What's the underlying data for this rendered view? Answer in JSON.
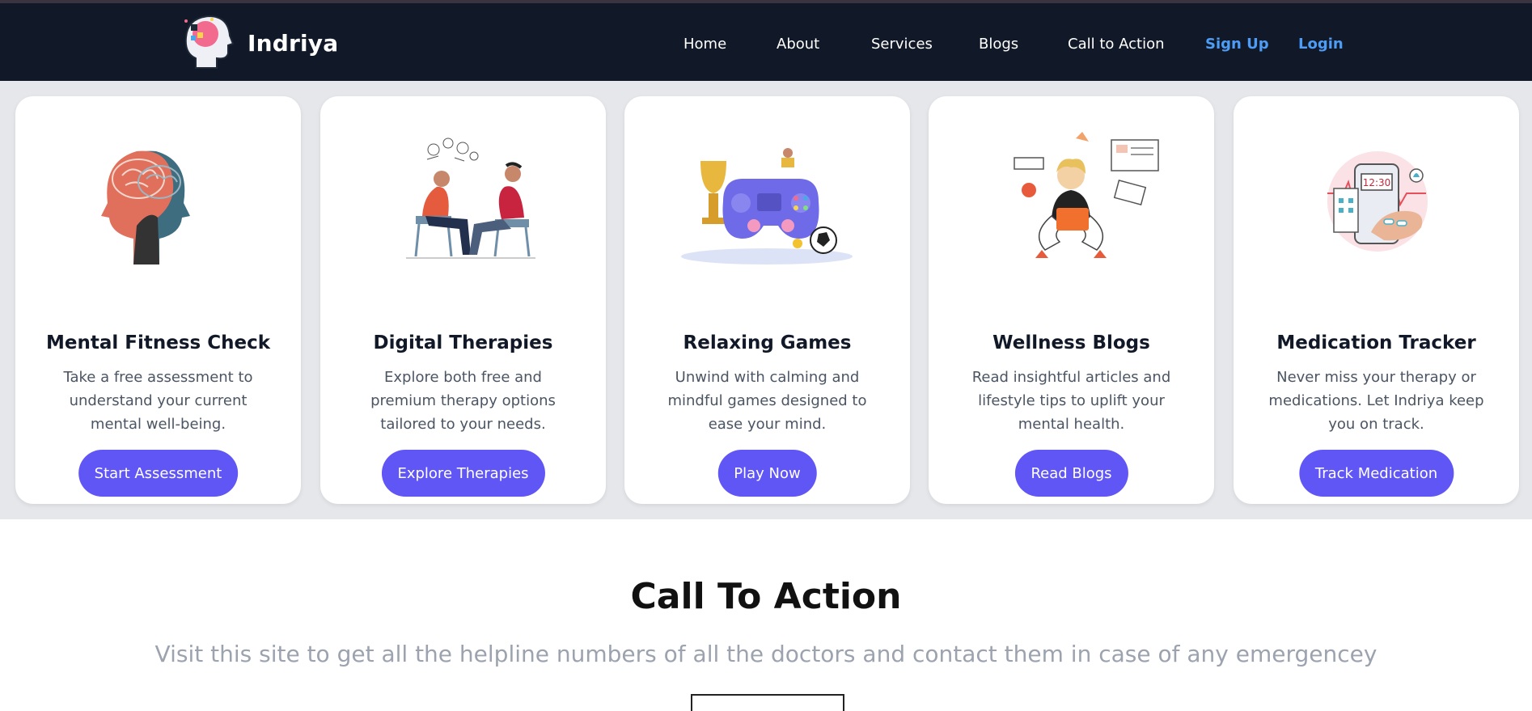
{
  "brand": {
    "name": "Indriya",
    "logo_icon": "brain-head-logo-icon"
  },
  "nav": {
    "links": [
      "Home",
      "About",
      "Services",
      "Blogs",
      "Call to Action"
    ],
    "signup": "Sign Up",
    "login": "Login",
    "accent_color": "#4d9cf5"
  },
  "services": [
    {
      "title": "Mental Fitness Check",
      "description": "Take a free assessment to understand your current mental well-being.",
      "button": "Start Assessment",
      "icon": "twin-heads-brain-illustration"
    },
    {
      "title": "Digital Therapies",
      "description": "Explore both free and premium therapy options tailored to your needs.",
      "button": "Explore Therapies",
      "icon": "therapy-session-illustration"
    },
    {
      "title": "Relaxing Games",
      "description": "Unwind with calming and mindful games designed to ease your mind.",
      "button": "Play Now",
      "icon": "game-controller-illustration"
    },
    {
      "title": "Wellness Blogs",
      "description": "Read insightful articles and lifestyle tips to uplift your mental health.",
      "button": "Read Blogs",
      "icon": "person-laptop-illustration"
    },
    {
      "title": "Medication Tracker",
      "description": "Never miss your therapy or medications. Let Indriya keep you on track.",
      "button": "Track Medication",
      "icon": "medication-phone-illustration"
    }
  ],
  "medication_clock": "12:30",
  "cta": {
    "title": "Call To Action",
    "subtitle": "Visit this site to get all the helpline numbers of all the doctors and contact them in case of any emergencey"
  },
  "colors": {
    "nav_bg": "#111827",
    "button": "#6055f5",
    "section_bg": "#e5e7eb"
  }
}
